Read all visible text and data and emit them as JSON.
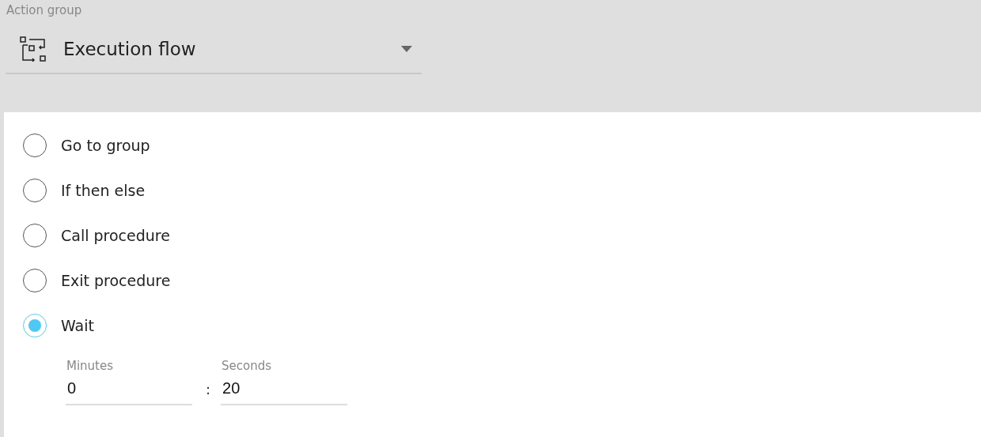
{
  "action_group": {
    "label": "Action group",
    "value": "Execution flow"
  },
  "options": [
    {
      "label": "Go to group",
      "selected": false
    },
    {
      "label": "If then else",
      "selected": false
    },
    {
      "label": "Call procedure",
      "selected": false
    },
    {
      "label": "Exit procedure",
      "selected": false
    },
    {
      "label": "Wait",
      "selected": true
    }
  ],
  "wait": {
    "minutes": {
      "label": "Minutes",
      "value": "0"
    },
    "separator": ":",
    "seconds": {
      "label": "Seconds",
      "value": "20"
    }
  }
}
